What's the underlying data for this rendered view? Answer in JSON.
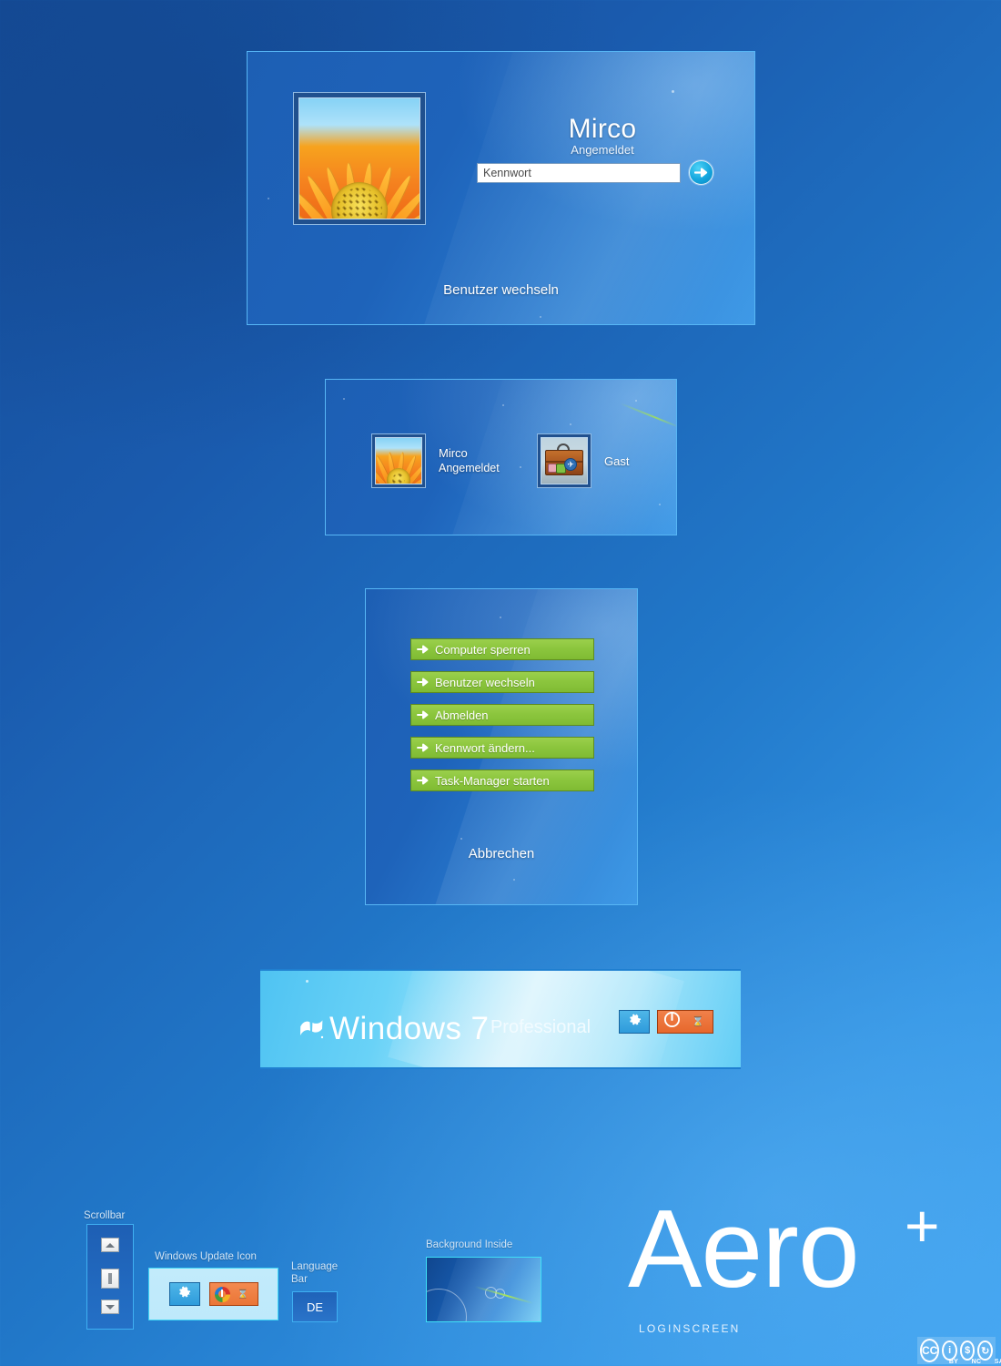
{
  "theme": {
    "name": "Aero+",
    "subtitle": "LOGINSCREEN",
    "accent_green": "#8CC63E",
    "accent_cyan": "#14A6DE",
    "accent_orange": "#E7672C",
    "panel_blue": "#1E63BA",
    "desktop_top": "#154C98",
    "desktop_bottom": "#3EA2F0"
  },
  "login_panel": {
    "user_name": "Mirco",
    "user_status": "Angemeldet",
    "password_placeholder": "Kennwort",
    "password_value": "",
    "submit_icon": "arrow-right-icon",
    "switch_user_label": "Benutzer wechseln",
    "avatar_icon": "flower-avatar"
  },
  "user_select_panel": {
    "users": [
      {
        "name": "Mirco",
        "status": "Angemeldet",
        "avatar": "flower-avatar"
      },
      {
        "name": "Gast",
        "status": "",
        "avatar": "suitcase-avatar"
      }
    ]
  },
  "options_panel": {
    "buttons": [
      {
        "label": "Computer sperren",
        "icon": "arrow-right-icon"
      },
      {
        "label": "Benutzer wechseln",
        "icon": "arrow-right-icon"
      },
      {
        "label": "Abmelden",
        "icon": "arrow-right-icon"
      },
      {
        "label": "Kennwort ändern...",
        "icon": "arrow-right-icon"
      },
      {
        "label": "Task-Manager starten",
        "icon": "arrow-right-icon"
      }
    ],
    "cancel_label": "Abbrechen"
  },
  "branding_bar": {
    "windows_word": "Windows",
    "version": "7",
    "edition": "Professional",
    "logo_icon": "windows-flag-icon",
    "ease_of_access_icon": "gear-icon",
    "power_icon": "power-icon",
    "power_secondary_icon": "hourglass-icon"
  },
  "widgets": {
    "scrollbar": {
      "caption": "Scrollbar",
      "up_icon": "triangle-up-icon",
      "thumb_icon": "scrollbar-thumb",
      "down_icon": "triangle-down-icon"
    },
    "windows_update": {
      "caption": "Windows Update Icon",
      "gear_icon": "gear-icon",
      "update_icon": "windows-update-ring-icon",
      "hourglass_icon": "hourglass-icon"
    },
    "language_bar": {
      "caption_line1": "Language",
      "caption_line2": "Bar",
      "value": "DE"
    },
    "background_inside": {
      "caption": "Background Inside"
    }
  },
  "license": {
    "mark": "CC",
    "terms": [
      "BY",
      "NC",
      "SA"
    ],
    "glyphs": [
      "i",
      "$",
      "↻"
    ]
  }
}
